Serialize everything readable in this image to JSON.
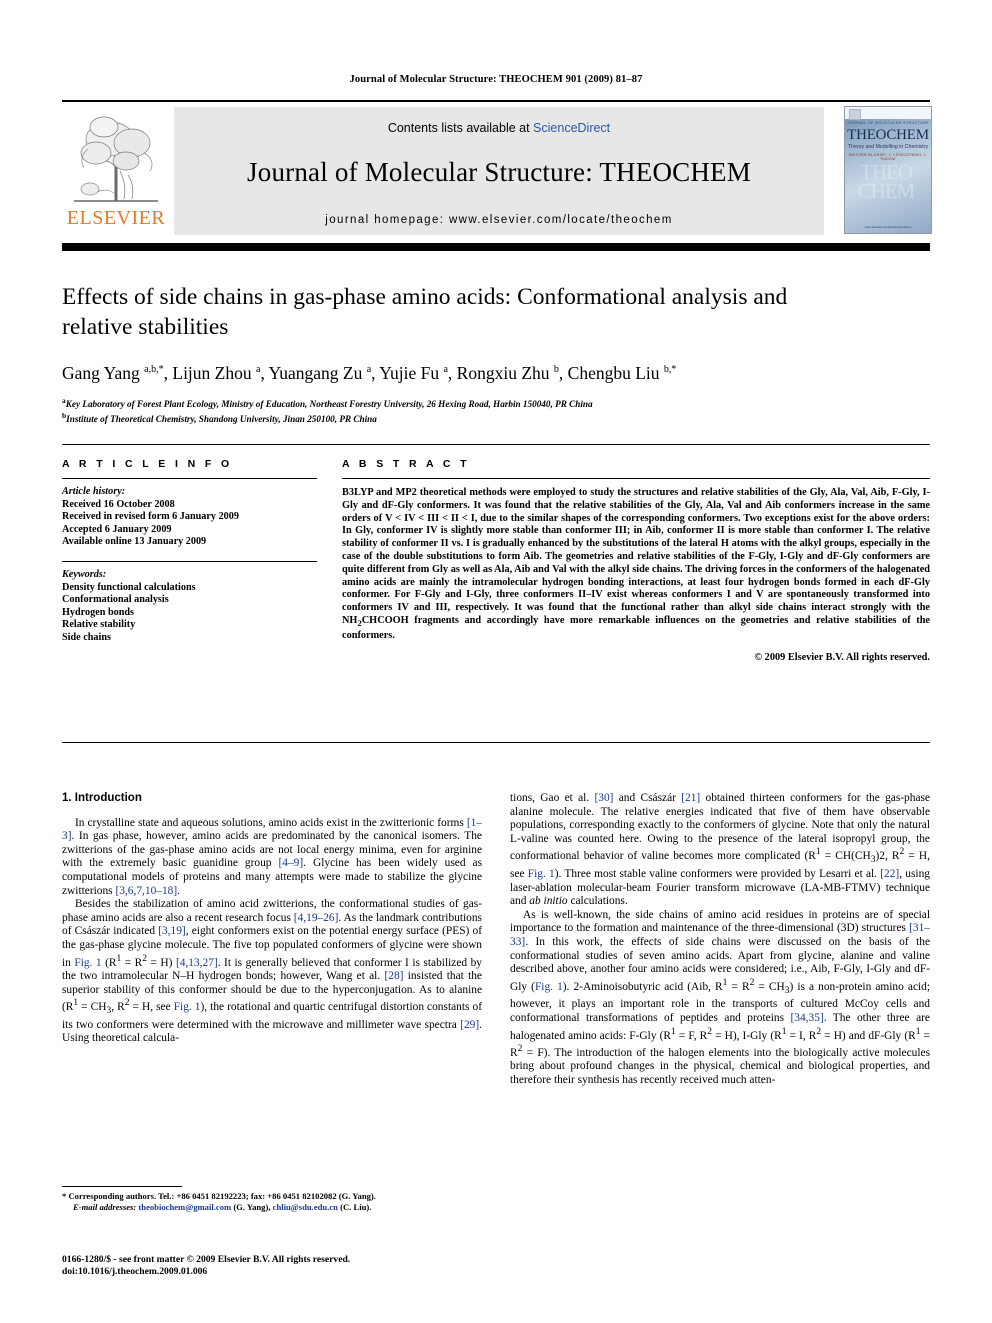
{
  "running_head": "Journal of Molecular Structure: THEOCHEM 901 (2009) 81–87",
  "masthead": {
    "contents_prefix": "Contents lists available at ",
    "sciencedirect": "ScienceDirect",
    "journal_title": "Journal of Molecular Structure: THEOCHEM",
    "homepage": "journal homepage: www.elsevier.com/locate/theochem",
    "publisher_name": "ELSEVIER",
    "publisher_color": "#E87722",
    "link_color": "#2b57a8",
    "cover": {
      "masthead_small": "JOURNAL OF MOLECULAR STRUCTURE",
      "name": "THEOCHEM",
      "tagline": "Theory and Modelling in Chemistry",
      "tagline2": "EDITORS-IN-CHIEF: J. LESZCZYNSKI, L. RADOM",
      "ghost": "THEO CHEM",
      "footer": "www.elsevier.com/locate/theochem"
    }
  },
  "article": {
    "title": "Effects of side chains in gas-phase amino acids: Conformational analysis and relative stabilities",
    "authors_html": "Gang Yang <sup>a,b,*</sup>, Lijun Zhou <sup>a</sup>, Yuangang Zu <sup>a</sup>, Yujie Fu <sup>a</sup>, Rongxiu Zhu <sup>b</sup>, Chengbu Liu <sup>b,*</sup>",
    "affiliations": [
      "Key Laboratory of Forest Plant Ecology, Ministry of Education, Northeast Forestry University, 26 Hexing Road, Harbin 150040, PR China",
      "Institute of Theoretical Chemistry, Shandong University, Jinan 250100, PR China"
    ]
  },
  "article_info": {
    "heading": "A R T I C L E    I N F O",
    "history_label": "Article history:",
    "history": [
      "Received 16 October 2008",
      "Received in revised form 6 January 2009",
      "Accepted 6 January 2009",
      "Available online 13 January 2009"
    ],
    "keywords_label": "Keywords:",
    "keywords": [
      "Density functional calculations",
      "Conformational analysis",
      "Hydrogen bonds",
      "Relative stability",
      "Side chains"
    ]
  },
  "abstract": {
    "heading": "A B S T R A C T",
    "text": "B3LYP and MP2 theoretical methods were employed to study the structures and relative stabilities of the Gly, Ala, Val, Aib, F-Gly, I-Gly and dF-Gly conformers. It was found that the relative stabilities of the Gly, Ala, Val and Aib conformers increase in the same orders of V < IV < III < II < I, due to the similar shapes of the corresponding conformers. Two exceptions exist for the above orders: In Gly, conformer IV is slightly more stable than conformer III; in Aib, conformer II is more stable than conformer I. The relative stability of conformer II vs. I is gradually enhanced by the substitutions of the lateral H atoms with the alkyl groups, especially in the case of the double substitutions to form Aib. The geometries and relative stabilities of the F-Gly, I-Gly and dF-Gly conformers are quite different from Gly as well as Ala, Aib and Val with the alkyl side chains. The driving forces in the conformers of the halogenated amino acids are mainly the intramolecular hydrogen bonding interactions, at least four hydrogen bonds formed in each dF-Gly conformer. For F-Gly and I-Gly, three conformers II–IV exist whereas conformers I and V are spontaneously transformed into conformers IV and III, respectively. It was found that the functional rather than alkyl side chains interact strongly with the NH2CHCOOH fragments and accordingly have more remarkable influences on the geometries and relative stabilities of the conformers.",
    "copyright": "© 2009 Elsevier B.V. All rights reserved."
  },
  "body": {
    "section_title": "1. Introduction",
    "left_paragraphs": [
      "In crystalline state and aqueous solutions, amino acids exist in the zwitterionic forms [1–3]. In gas phase, however, amino acids are predominated by the canonical isomers. The zwitterions of the gas-phase amino acids are not local energy minima, even for arginine with the extremely basic guanidine group [4–9]. Glycine has been widely used as computational models of proteins and many attempts were made to stabilize the glycine zwitterions [3,6,7,10–18].",
      "Besides the stabilization of amino acid zwitterions, the conformational studies of gas-phase amino acids are also a recent research focus [4,19–26]. As the landmark contributions of Császár indicated [3,19], eight conformers exist on the potential energy surface (PES) of the gas-phase glycine molecule. The five top populated conformers of glycine were shown in Fig. 1 (R1 = R2 = H) [4,13,27]. It is generally believed that conformer I is stabilized by the two intramolecular N–H hydrogen bonds; however, Wang et al. [28] insisted that the superior stability of this conformer should be due to the hyperconjugation. As to alanine (R1 = CH3, R2 = H, see Fig. 1), the rotational and quartic centrifugal distortion constants of its two conformers were determined with the microwave and millimeter wave spectra [29]. Using theoretical calcula-"
    ],
    "right_paragraphs": [
      "tions, Gao et al. [30] and Császár [21] obtained thirteen conformers for the gas-phase alanine molecule. The relative energies indicated that five of them have observable populations, corresponding exactly to the conformers of glycine. Note that only the natural L-valine was counted here. Owing to the presence of the lateral isopropyl group, the conformational behavior of valine becomes more complicated (R1 = CH(CH3)2, R2 = H, see Fig. 1). Three most stable valine conformers were provided by Lesarri et al. [22], using laser-ablation molecular-beam Fourier transform microwave (LA-MB-FTMV) technique and ab initio calculations.",
      "As is well-known, the side chains of amino acid residues in proteins are of special importance to the formation and maintenance of the three-dimensional (3D) structures [31–33]. In this work, the effects of side chains were discussed on the basis of the conformational studies of seven amino acids. Apart from glycine, alanine and valine described above, another four amino acids were considered; i.e., Aib, F-Gly, I-Gly and dF-Gly (Fig. 1). 2-Aminoisobutyric acid (Aib, R1 = R2 = CH3) is a non-protein amino acid; however, it plays an important role in the transports of cultured McCoy cells and conformational transformations of peptides and proteins [34,35]. The other three are halogenated amino acids: F-Gly (R1 = F, R2 = H), I-Gly (R1 = I, R2 = H) and dF-Gly (R1 = R2 = F). The introduction of the halogen elements into the biologically active molecules bring about profound changes in the physical, chemical and biological properties, and therefore their synthesis has recently received much atten-"
    ]
  },
  "footnote": {
    "star": "*",
    "corresponding": "Corresponding authors. Tel.: +86 0451 82192223; fax: +86 0451 82102082 (G. Yang).",
    "email_label": "E-mail addresses:",
    "email1": "theobiochem@gmail.com",
    "email1_owner": "(G. Yang),",
    "email2": "chliu@sdu.edu.cn",
    "email2_owner": "(C. Liu)."
  },
  "bottom_matter": {
    "issn_line": "0166-1280/$ - see front matter © 2009 Elsevier B.V. All rights reserved.",
    "doi_line": "doi:10.1016/j.theochem.2009.01.006"
  }
}
